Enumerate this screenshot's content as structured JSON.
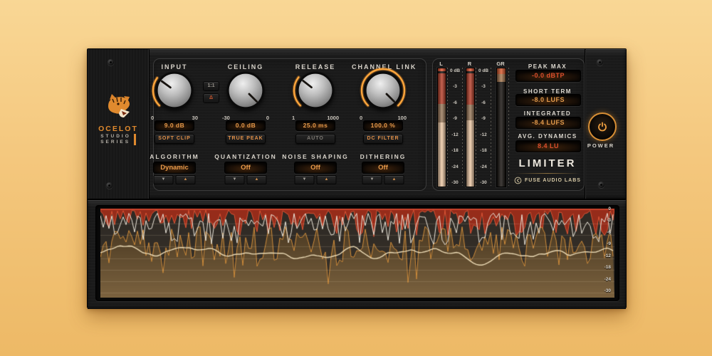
{
  "brand": {
    "title": "OCELOT",
    "sub_line1": "STUDIO",
    "sub_line2": "SERIES"
  },
  "controls": {
    "knobs": [
      {
        "label": "INPUT",
        "min_label": "0",
        "max_label": "30",
        "value_text": "9.0 dB",
        "toggle_label": "SOFT CLIP",
        "toggle_active": true,
        "pointer_deg": -54,
        "arc_start_deg": -135,
        "arc_end_deg": -54
      },
      {
        "label": "CEILING",
        "min_label": "-30",
        "max_label": "0",
        "value_text": "0.0 dB",
        "toggle_label": "TRUE PEAK",
        "toggle_active": true,
        "pointer_deg": 135,
        "arc_start_deg": null,
        "arc_end_deg": null
      },
      {
        "label": "RELEASE",
        "min_label": "1",
        "max_label": "1000",
        "value_text": "25.0 ms",
        "toggle_label": "AUTO",
        "toggle_active": false,
        "pointer_deg": -52,
        "arc_start_deg": -135,
        "arc_end_deg": -52
      },
      {
        "label": "CHANNEL LINK",
        "min_label": "0",
        "max_label": "100",
        "value_text": "100.0 %",
        "toggle_label": "DC FILTER",
        "toggle_active": true,
        "pointer_deg": 135,
        "arc_start_deg": -135,
        "arc_end_deg": 135
      }
    ],
    "small_buttons": {
      "ratio": "1:1",
      "delta": "Δ"
    },
    "stepper": {
      "down": "▼",
      "up": "▲"
    },
    "selectors": [
      {
        "label": "ALGORITHM",
        "value": "Dynamic"
      },
      {
        "label": "QUANTIZATION",
        "value": "Off"
      },
      {
        "label": "NOISE SHAPING",
        "value": "Off"
      },
      {
        "label": "DITHERING",
        "value": "Off"
      }
    ]
  },
  "meters": {
    "scale_labels": [
      "0 dB",
      "-3",
      "-6",
      "-9",
      "-12",
      "-18",
      "-24",
      "-30"
    ],
    "channels": [
      {
        "label": "L",
        "zones": [
          {
            "color": "#e05330",
            "from": 0,
            "to": 0.022
          },
          {
            "color": "#17120e",
            "from": 0.022,
            "to": 0.045
          },
          {
            "color": "#b8402a",
            "from": 0.045,
            "to": 0.3
          },
          {
            "color": "#9b7a5b",
            "from": 0.3,
            "to": 0.46
          },
          {
            "color": "#efcaa6",
            "from": 0.46,
            "to": 1
          }
        ]
      },
      {
        "label": "R",
        "zones": [
          {
            "color": "#e05330",
            "from": 0,
            "to": 0.022
          },
          {
            "color": "#17120e",
            "from": 0.022,
            "to": 0.04
          },
          {
            "color": "#b8402a",
            "from": 0.04,
            "to": 0.305
          },
          {
            "color": "#9b7a5b",
            "from": 0.305,
            "to": 0.44
          },
          {
            "color": "#efcaa6",
            "from": 0.44,
            "to": 1
          }
        ]
      },
      {
        "label": "GR",
        "zones": [
          {
            "color": "#d85a2e",
            "from": 0,
            "to": 0.05
          },
          {
            "color": "#a97a50",
            "from": 0.05,
            "to": 0.115
          },
          {
            "color": "#16120e",
            "from": 0.115,
            "to": 1
          }
        ]
      }
    ]
  },
  "readouts": [
    {
      "label": "PEAK MAX",
      "value": "-0.0 dBTP",
      "color": "red"
    },
    {
      "label": "SHORT TERM",
      "value": "-8.0 LUFS",
      "color": "orange"
    },
    {
      "label": "INTEGRATED",
      "value": "-8.4 LUFS",
      "color": "orange"
    },
    {
      "label": "AVG. DYNAMICS",
      "value": "8.4 LU",
      "color": "red"
    }
  ],
  "plugin_name": "LIMITER",
  "vendor": "FUSE AUDIO LABS",
  "power_label": "POWER",
  "waveform": {
    "scale_labels": [
      "0",
      "-3",
      "-6",
      "-9",
      "-12",
      "-18",
      "-24",
      "-30"
    ]
  },
  "colors": {
    "accent_orange": "#ef9b3a",
    "lcd_text": "#e89a4a",
    "value_red": "#dd4f2c",
    "meter_red": "#b8402a",
    "meter_tan": "#9b7a5b",
    "meter_peach": "#efcaa6",
    "background": "#f4c77d"
  }
}
